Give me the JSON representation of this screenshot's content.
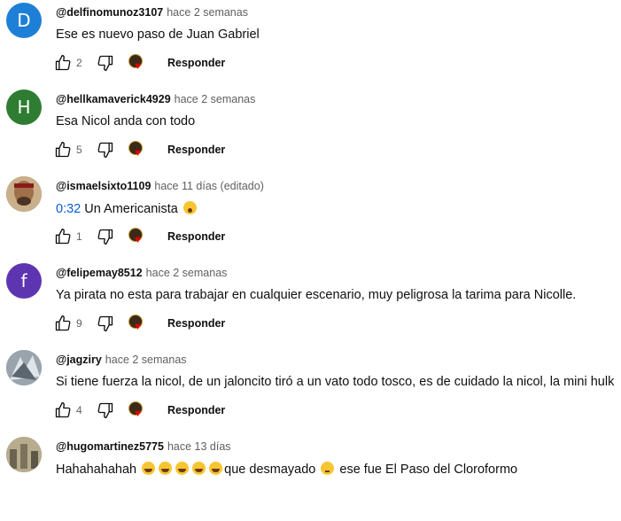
{
  "comments": [
    {
      "avatar_letter": "D",
      "avatar_color": "#1e7fd6",
      "username": "@delfinomunoz3107",
      "time": "hace 2 semanas",
      "text": "Ese es nuevo paso de Juan Gabriel",
      "likes": "2",
      "reply_label": "Responder"
    },
    {
      "avatar_letter": "H",
      "avatar_color": "#2e7d32",
      "username": "@hellkamaverick4929",
      "time": "hace 2 semanas",
      "text": "Esa Nicol anda con todo",
      "likes": "5",
      "reply_label": "Responder"
    },
    {
      "username": "@ismaelsixto1109",
      "time": "hace 11 días (editado)",
      "timestamp_link": "0:32",
      "text": " Un Americanista ",
      "likes": "1",
      "reply_label": "Responder"
    },
    {
      "avatar_letter": "f",
      "avatar_color": "#5e35b1",
      "username": "@felipemay8512",
      "time": "hace 2 semanas",
      "text": "Ya pirata no esta para trabajar en cualquier escenario, muy peligrosa la tarima para Nicolle.",
      "likes": "9",
      "reply_label": "Responder"
    },
    {
      "username": "@jagziry",
      "time": "hace 2 semanas",
      "text": "Si tiene fuerza la nicol, de un jaloncito tiró a un vato todo tosco, es de cuidado la nicol, la mini hulk",
      "likes": "4",
      "reply_label": "Responder"
    },
    {
      "username": "@hugomartinez5775",
      "time": "hace 13 días",
      "text_part1": "Hahahahahah ",
      "text_part2": "que desmayado ",
      "text_part3": " ese fue El Paso del Cloroformo"
    }
  ]
}
